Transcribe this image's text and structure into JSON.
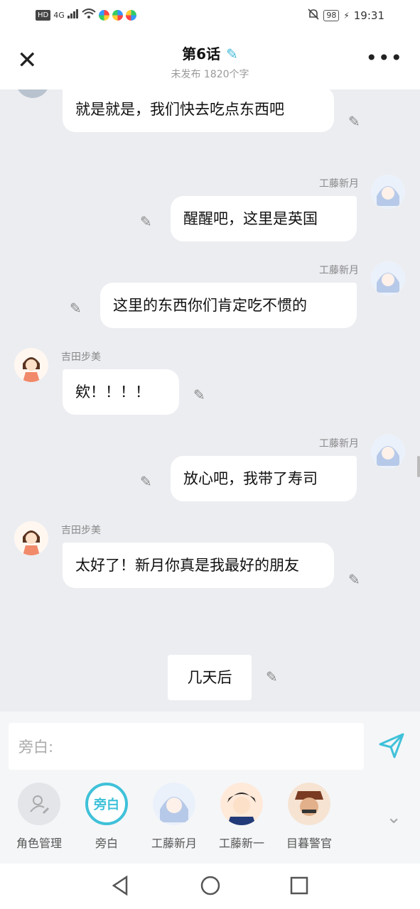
{
  "status": {
    "time": "19:31",
    "battery": "98",
    "hd": "HD",
    "network": "4G"
  },
  "header": {
    "title": "第6话",
    "subtitle": "未发布 1820个字"
  },
  "messages": [
    {
      "text": "就是就是，我们快去吃点东西吧"
    },
    {
      "speaker": "工藤新月",
      "text": "醒醒吧，这里是英国"
    },
    {
      "speaker": "工藤新月",
      "text": "这里的东西你们肯定吃不惯的"
    },
    {
      "speaker": "吉田步美",
      "text": "欸！！！！"
    },
    {
      "speaker": "工藤新月",
      "text": "放心吧，我带了寿司"
    },
    {
      "speaker": "吉田步美",
      "text": "太好了！新月你真是我最好的朋友"
    },
    {
      "text": "几天后"
    }
  ],
  "composer": {
    "placeholder": "旁白:"
  },
  "roles": [
    {
      "label": "角色管理",
      "icon": "person-edit-icon"
    },
    {
      "label": "旁白",
      "badge": "旁白"
    },
    {
      "label": "工藤新月"
    },
    {
      "label": "工藤新一"
    },
    {
      "label": "目暮警官"
    }
  ],
  "colors": {
    "accent": "#3fc1d9",
    "background": "#ecedf1"
  }
}
